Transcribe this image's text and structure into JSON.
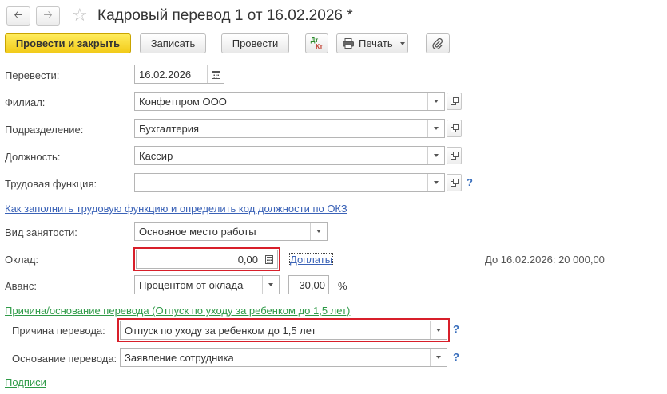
{
  "header": {
    "title": "Кадровый перевод 1 от 16.02.2026 *"
  },
  "toolbar": {
    "post_close": "Провести и закрыть",
    "save": "Записать",
    "post": "Провести",
    "dtkt_top": "Дт",
    "dtkt_bottom": "Кт",
    "print": "Печать"
  },
  "form": {
    "transfer_label": "Перевести:",
    "transfer_date": "16.02.2026",
    "branch_label": "Филиал:",
    "branch_value": "Конфетпром ООО",
    "department_label": "Подразделение:",
    "department_value": "Бухгалтерия",
    "position_label": "Должность:",
    "position_value": "Кассир",
    "labor_function_label": "Трудовая функция:",
    "labor_function_value": "",
    "okz_link": "Как заполнить трудовую функцию и определить код должности по ОКЗ",
    "employment_type_label": "Вид занятости:",
    "employment_type_value": "Основное место работы",
    "salary_label": "Оклад:",
    "salary_value": "0,00",
    "surcharges_link": "Доплаты",
    "salary_hint": "До 16.02.2026: 20 000,00",
    "advance_label": "Аванс:",
    "advance_type_value": "Процентом от оклада",
    "advance_percent_value": "30,00",
    "advance_percent_sign": "%",
    "reason_group_link": "Причина/основание перевода (Отпуск по уходу за ребенком до 1,5 лет)",
    "reason_label": "Причина перевода:",
    "reason_value": "Отпуск по уходу за ребенком до 1,5 лет",
    "basis_label": "Основание перевода:",
    "basis_value": "Заявление сотрудника",
    "signatures_link": "Подписи",
    "help_mark": "?"
  }
}
